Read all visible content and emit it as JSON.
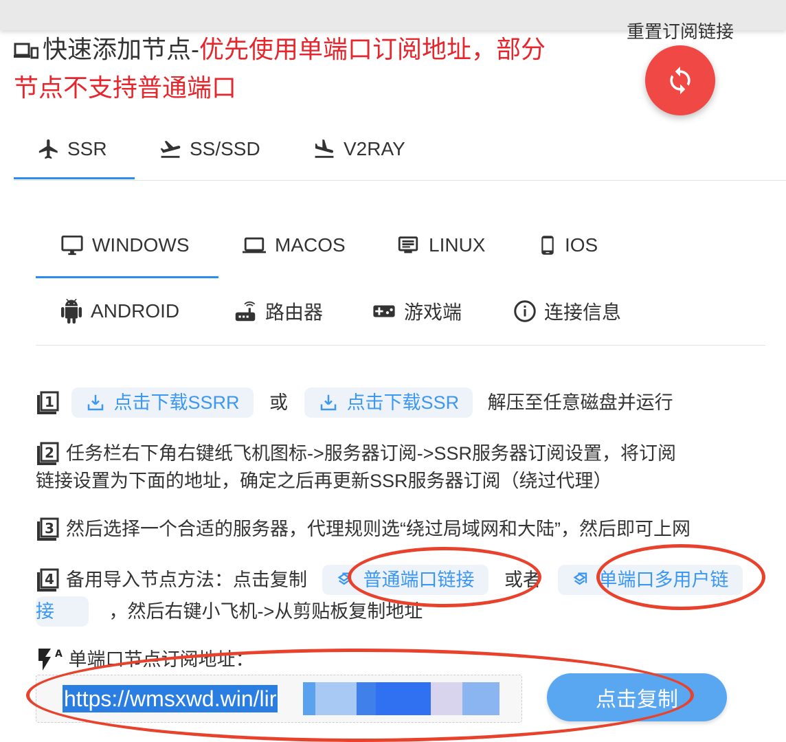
{
  "header": {
    "reset_label": "重置订阅链接",
    "title_black": "快速添加节点-",
    "title_red_line1": "优先使用单端口订阅地址，部分",
    "title_red_line2": "节点不支持普通端口"
  },
  "protocol_tabs": [
    {
      "label": "SSR",
      "icon": "airplane-icon"
    },
    {
      "label": "SS/SSD",
      "icon": "flight-takeoff-icon"
    },
    {
      "label": "V2RAY",
      "icon": "flight-land-icon"
    }
  ],
  "platform_tabs": [
    {
      "label": "WINDOWS",
      "icon": "monitor-icon"
    },
    {
      "label": "MACOS",
      "icon": "laptop-icon"
    },
    {
      "label": "LINUX",
      "icon": "terminal-icon"
    },
    {
      "label": "IOS",
      "icon": "phone-icon"
    },
    {
      "label": "ANDROID",
      "icon": "android-icon"
    },
    {
      "label": "路由器",
      "icon": "router-icon"
    },
    {
      "label": "游戏端",
      "icon": "gamepad-icon"
    },
    {
      "label": "连接信息",
      "icon": "info-icon"
    }
  ],
  "steps": {
    "s1": {
      "btn1": "点击下载SSRR",
      "or": "或",
      "btn2": "点击下载SSR",
      "tail": "解压至任意磁盘并运行"
    },
    "s2": {
      "line1": "任务栏右下角右键纸飞机图标->服务器订阅->SSR服务器订阅设置，将订阅",
      "line2": "链接设置为下面的地址，确定之后再更新SSR服务器订阅（绕过代理）"
    },
    "s3": {
      "text": "然后选择一个合适的服务器，代理规则选“绕过局域网和大陆”，然后即可上网"
    },
    "s4": {
      "prefix": "备用导入节点方法：点击复制",
      "btn1": "普通端口链接",
      "or": "或者",
      "btn2_part1": "单端口多用户链",
      "btn2_part2": "接",
      "tail": "，然后右键小飞机->从剪贴板复制地址"
    }
  },
  "subscription": {
    "label": "单端口节点订阅地址：",
    "url_visible": "https://wmsxwd.win/lir",
    "copy_button": "点击复制"
  },
  "colors": {
    "accent": "#2d8cf0",
    "red": "#e5262d",
    "fab": "#f04844",
    "annotation": "#e8422d"
  }
}
